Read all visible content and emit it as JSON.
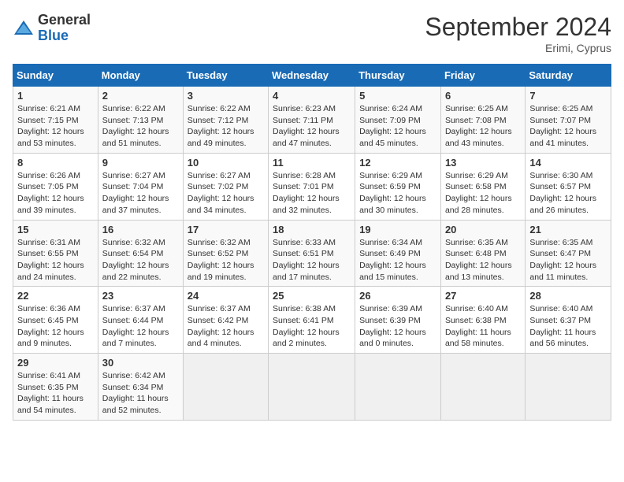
{
  "header": {
    "logo_general": "General",
    "logo_blue": "Blue",
    "month_title": "September 2024",
    "location": "Erimi, Cyprus"
  },
  "days_of_week": [
    "Sunday",
    "Monday",
    "Tuesday",
    "Wednesday",
    "Thursday",
    "Friday",
    "Saturday"
  ],
  "weeks": [
    [
      {
        "num": "1",
        "sunrise": "6:21 AM",
        "sunset": "7:15 PM",
        "daylight": "12 hours and 53 minutes."
      },
      {
        "num": "2",
        "sunrise": "6:22 AM",
        "sunset": "7:13 PM",
        "daylight": "12 hours and 51 minutes."
      },
      {
        "num": "3",
        "sunrise": "6:22 AM",
        "sunset": "7:12 PM",
        "daylight": "12 hours and 49 minutes."
      },
      {
        "num": "4",
        "sunrise": "6:23 AM",
        "sunset": "7:11 PM",
        "daylight": "12 hours and 47 minutes."
      },
      {
        "num": "5",
        "sunrise": "6:24 AM",
        "sunset": "7:09 PM",
        "daylight": "12 hours and 45 minutes."
      },
      {
        "num": "6",
        "sunrise": "6:25 AM",
        "sunset": "7:08 PM",
        "daylight": "12 hours and 43 minutes."
      },
      {
        "num": "7",
        "sunrise": "6:25 AM",
        "sunset": "7:07 PM",
        "daylight": "12 hours and 41 minutes."
      }
    ],
    [
      {
        "num": "8",
        "sunrise": "6:26 AM",
        "sunset": "7:05 PM",
        "daylight": "12 hours and 39 minutes."
      },
      {
        "num": "9",
        "sunrise": "6:27 AM",
        "sunset": "7:04 PM",
        "daylight": "12 hours and 37 minutes."
      },
      {
        "num": "10",
        "sunrise": "6:27 AM",
        "sunset": "7:02 PM",
        "daylight": "12 hours and 34 minutes."
      },
      {
        "num": "11",
        "sunrise": "6:28 AM",
        "sunset": "7:01 PM",
        "daylight": "12 hours and 32 minutes."
      },
      {
        "num": "12",
        "sunrise": "6:29 AM",
        "sunset": "6:59 PM",
        "daylight": "12 hours and 30 minutes."
      },
      {
        "num": "13",
        "sunrise": "6:29 AM",
        "sunset": "6:58 PM",
        "daylight": "12 hours and 28 minutes."
      },
      {
        "num": "14",
        "sunrise": "6:30 AM",
        "sunset": "6:57 PM",
        "daylight": "12 hours and 26 minutes."
      }
    ],
    [
      {
        "num": "15",
        "sunrise": "6:31 AM",
        "sunset": "6:55 PM",
        "daylight": "12 hours and 24 minutes."
      },
      {
        "num": "16",
        "sunrise": "6:32 AM",
        "sunset": "6:54 PM",
        "daylight": "12 hours and 22 minutes."
      },
      {
        "num": "17",
        "sunrise": "6:32 AM",
        "sunset": "6:52 PM",
        "daylight": "12 hours and 19 minutes."
      },
      {
        "num": "18",
        "sunrise": "6:33 AM",
        "sunset": "6:51 PM",
        "daylight": "12 hours and 17 minutes."
      },
      {
        "num": "19",
        "sunrise": "6:34 AM",
        "sunset": "6:49 PM",
        "daylight": "12 hours and 15 minutes."
      },
      {
        "num": "20",
        "sunrise": "6:35 AM",
        "sunset": "6:48 PM",
        "daylight": "12 hours and 13 minutes."
      },
      {
        "num": "21",
        "sunrise": "6:35 AM",
        "sunset": "6:47 PM",
        "daylight": "12 hours and 11 minutes."
      }
    ],
    [
      {
        "num": "22",
        "sunrise": "6:36 AM",
        "sunset": "6:45 PM",
        "daylight": "12 hours and 9 minutes."
      },
      {
        "num": "23",
        "sunrise": "6:37 AM",
        "sunset": "6:44 PM",
        "daylight": "12 hours and 7 minutes."
      },
      {
        "num": "24",
        "sunrise": "6:37 AM",
        "sunset": "6:42 PM",
        "daylight": "12 hours and 4 minutes."
      },
      {
        "num": "25",
        "sunrise": "6:38 AM",
        "sunset": "6:41 PM",
        "daylight": "12 hours and 2 minutes."
      },
      {
        "num": "26",
        "sunrise": "6:39 AM",
        "sunset": "6:39 PM",
        "daylight": "12 hours and 0 minutes."
      },
      {
        "num": "27",
        "sunrise": "6:40 AM",
        "sunset": "6:38 PM",
        "daylight": "11 hours and 58 minutes."
      },
      {
        "num": "28",
        "sunrise": "6:40 AM",
        "sunset": "6:37 PM",
        "daylight": "11 hours and 56 minutes."
      }
    ],
    [
      {
        "num": "29",
        "sunrise": "6:41 AM",
        "sunset": "6:35 PM",
        "daylight": "11 hours and 54 minutes."
      },
      {
        "num": "30",
        "sunrise": "6:42 AM",
        "sunset": "6:34 PM",
        "daylight": "11 hours and 52 minutes."
      },
      null,
      null,
      null,
      null,
      null
    ]
  ]
}
